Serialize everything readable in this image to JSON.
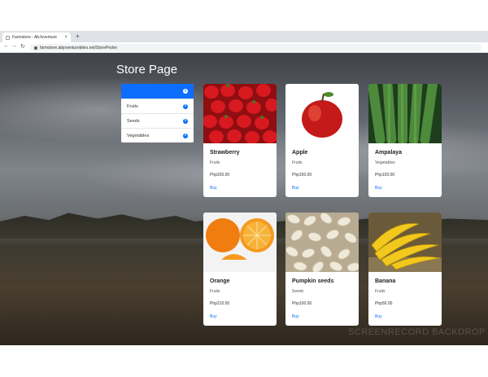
{
  "browser": {
    "tab_title": "Farmstore - AbJoventure",
    "tab_close": "×",
    "new_tab": "+",
    "back": "←",
    "forward": "→",
    "reload": "↻",
    "url": "farmstore.abjoventurebites.net/StorePedex"
  },
  "page": {
    "title": "Store Page",
    "watermark": "SCREENRECORD BACKDROP"
  },
  "categories": [
    {
      "label": "",
      "active": true
    },
    {
      "label": "Fruits",
      "active": false
    },
    {
      "label": "Seeds",
      "active": false
    },
    {
      "label": "Vegetables",
      "active": false
    }
  ],
  "info_glyph": "i",
  "products": [
    {
      "name": "Strawberry",
      "category": "Fruits",
      "price": "Php200.00",
      "buy": "Buy",
      "image": "strawberry"
    },
    {
      "name": "Apple",
      "category": "Fruits",
      "price": "Php150.00",
      "buy": "Buy",
      "image": "apple"
    },
    {
      "name": "Ampalaya",
      "category": "Vegetables",
      "price": "Php150.00",
      "buy": "Buy",
      "image": "ampalaya"
    },
    {
      "name": "Orange",
      "category": "Fruits",
      "price": "Php210.00",
      "buy": "Buy",
      "image": "orange"
    },
    {
      "name": "Pumpkin seeds",
      "category": "Seeds",
      "price": "Php100.00",
      "buy": "Buy",
      "image": "pumpkin-seeds"
    },
    {
      "name": "Banana",
      "category": "Fruits",
      "price": "Php50.00",
      "buy": "Buy",
      "image": "banana"
    }
  ],
  "colors": {
    "accent": "#0d6efd",
    "card_bg": "#ffffff"
  }
}
